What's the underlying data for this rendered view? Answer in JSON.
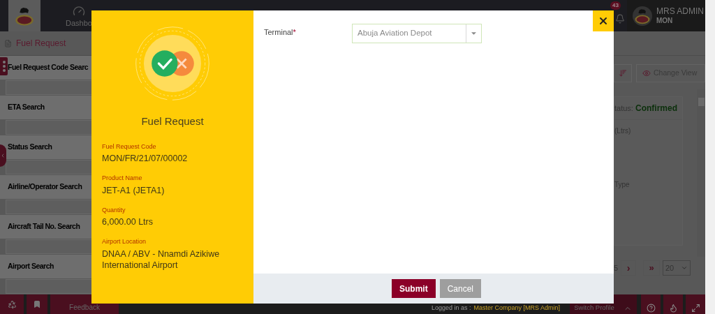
{
  "top_bar": {
    "nav_items": [
      {
        "label": "Dashbo"
      }
    ],
    "notification_count": "43",
    "user": {
      "name": "MRS ADMIN",
      "org": "MON"
    }
  },
  "page": {
    "title": "Fuel Request"
  },
  "filters": [
    {
      "label": "Fuel Request Code Searc"
    },
    {
      "label": "ETA Search"
    },
    {
      "label": "Status Search"
    },
    {
      "label": "Airline/Operator Search"
    },
    {
      "label": "Aircraft Tail No. Search"
    },
    {
      "label": "Airport Search"
    }
  ],
  "toolbar": {
    "change_view": "Change View"
  },
  "record": {
    "status_label": "tatus:",
    "status_value": "Confirmed",
    "column_1": "(Ltrs)",
    "column_2": "Type"
  },
  "pagination": {
    "page": "5",
    "next": "›",
    "last": "»",
    "page_size": "20"
  },
  "bottom_bar": {
    "feedback": "Feedback",
    "logged_in_label": "Logged in as :",
    "logged_in_value": "Master Company [MRS Admin]",
    "switch_profile": "Switch Profile"
  },
  "modal": {
    "title": "Fuel Request",
    "details": [
      {
        "label": "Fuel Request Code",
        "value": "MON/FR/21/07/00002"
      },
      {
        "label": "Product Name",
        "value": "JET-A1 (JETA1)"
      },
      {
        "label": "Quantity",
        "value": "6,000.00 Ltrs"
      },
      {
        "label": "Airport Location",
        "value": "DNAA / ABV - Nnamdi Azikiwe International Airport"
      }
    ],
    "fields": [
      {
        "label": "Terminal",
        "required": true,
        "required_mark": "*",
        "value": "Abuja Aviation Depot"
      }
    ],
    "buttons": [
      {
        "label": "Submit",
        "kind": "primary"
      },
      {
        "label": "Cancel",
        "kind": "secondary"
      }
    ]
  }
}
